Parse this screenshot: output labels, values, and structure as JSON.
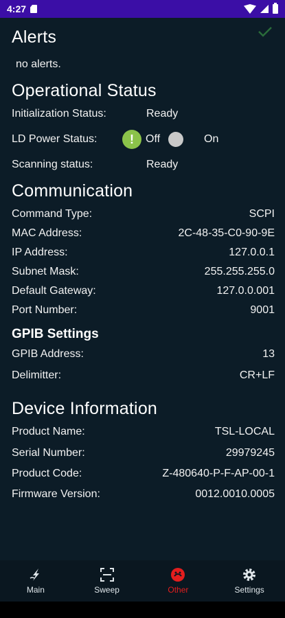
{
  "status_bar": {
    "time": "4:27"
  },
  "alerts": {
    "title": "Alerts",
    "message": "no alerts."
  },
  "operational": {
    "title": "Operational Status",
    "init_label": "Initialization Status:",
    "init_value": "Ready",
    "ld_label": "LD Power Status:",
    "ld_off": "Off",
    "ld_on": "On",
    "scan_label": "Scanning status:",
    "scan_value": "Ready"
  },
  "communication": {
    "title": "Communication",
    "rows": [
      {
        "label": "Command Type:",
        "value": "SCPI"
      },
      {
        "label": "MAC Address:",
        "value": "2C-48-35-C0-90-9E"
      },
      {
        "label": "IP Address:",
        "value": "127.0.0.1"
      },
      {
        "label": "Subnet Mask:",
        "value": "255.255.255.0"
      },
      {
        "label": "Default Gateway:",
        "value": "127.0.0.001"
      },
      {
        "label": "Port Number:",
        "value": "9001"
      }
    ]
  },
  "gpib": {
    "title": "GPIB Settings",
    "rows": [
      {
        "label": "GPIB Address:",
        "value": "13"
      },
      {
        "label": "Delimitter:",
        "value": "CR+LF"
      }
    ]
  },
  "device": {
    "title": "Device Information",
    "rows": [
      {
        "label": "Product Name:",
        "value": "TSL-LOCAL"
      },
      {
        "label": "Serial Number:",
        "value": "29979245"
      },
      {
        "label": "Product Code:",
        "value": "Z-480640-P-F-AP-00-1"
      },
      {
        "label": "Firmware Version:",
        "value": "0012.0010.0005"
      }
    ]
  },
  "nav": {
    "items": [
      {
        "label": "Main",
        "icon": "main-icon"
      },
      {
        "label": "Sweep",
        "icon": "sweep-icon"
      },
      {
        "label": "Other",
        "icon": "other-icon",
        "active": true
      },
      {
        "label": "Settings",
        "icon": "gear-icon"
      }
    ]
  },
  "colors": {
    "accent_active": "#e31e1e",
    "status_bar": "#3b0ea6",
    "warning": "#8bc34a",
    "background": "#0c1c27"
  }
}
